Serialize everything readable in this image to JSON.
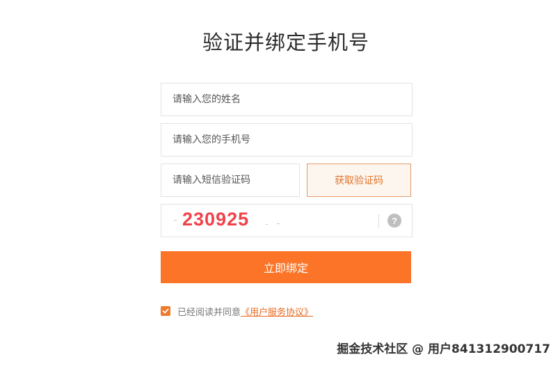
{
  "title": "验证并绑定手机号",
  "form": {
    "name_placeholder": "请输入您的姓名",
    "phone_placeholder": "请输入您的手机号",
    "code_placeholder": "请输入短信验证码",
    "get_code_label": "获取验证码",
    "captcha_text": "230925",
    "help_symbol": "?",
    "submit_label": "立即绑定"
  },
  "agreement": {
    "checked": true,
    "text": "已经阅读并同意",
    "link_text": "《用户服务协议》"
  },
  "watermark": "掘金技术社区 @ 用户841312900717",
  "colors": {
    "accent": "#fb7427",
    "captcha": "#f0424a",
    "link": "#e96a1f"
  }
}
